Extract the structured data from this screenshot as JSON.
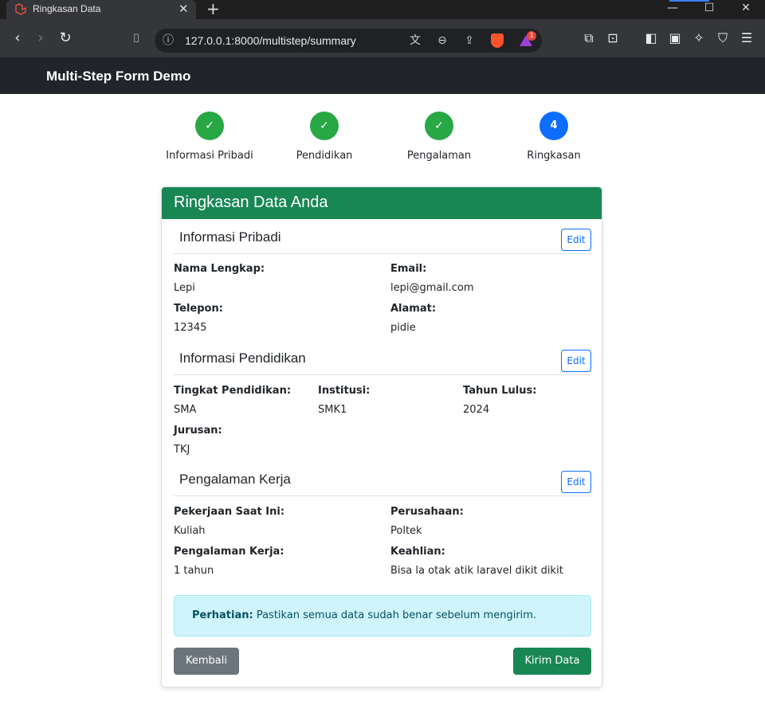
{
  "browser": {
    "tab_title": "Ringkasan Data",
    "url": "127.0.0.1:8000/multistep/summary",
    "rewards_badge": "1"
  },
  "app": {
    "brand": "Multi-Step Form Demo"
  },
  "steps": [
    {
      "label": "Informasi Pribadi",
      "marker": "✓",
      "status": "done"
    },
    {
      "label": "Pendidikan",
      "marker": "✓",
      "status": "done"
    },
    {
      "label": "Pengalaman",
      "marker": "✓",
      "status": "done"
    },
    {
      "label": "Ringkasan",
      "marker": "4",
      "status": "active"
    }
  ],
  "card": {
    "title": "Ringkasan Data Anda",
    "edit_label": "Edit",
    "personal": {
      "title": "Informasi Pribadi",
      "name_label": "Nama Lengkap:",
      "name": "Lepi",
      "email_label": "Email:",
      "email": "lepi@gmail.com",
      "phone_label": "Telepon:",
      "phone": "12345",
      "address_label": "Alamat:",
      "address": "pidie"
    },
    "education": {
      "title": "Informasi Pendidikan",
      "level_label": "Tingkat Pendidikan:",
      "level": "SMA",
      "institution_label": "Institusi:",
      "institution": "SMK1",
      "year_label": "Tahun Lulus:",
      "year": "2024",
      "major_label": "Jurusan:",
      "major": "TKJ"
    },
    "experience": {
      "title": "Pengalaman Kerja",
      "job_label": "Pekerjaan Saat Ini:",
      "job": "Kuliah",
      "company_label": "Perusahaan:",
      "company": "Poltek",
      "years_label": "Pengalaman Kerja:",
      "years": "1 tahun",
      "skills_label": "Keahlian:",
      "skills": "Bisa la otak atik laravel dikit dikit"
    },
    "alert": {
      "strong": "Perhatian:",
      "text": " Pastikan semua data sudah benar sebelum mengirim."
    },
    "back_label": "Kembali",
    "submit_label": "Kirim Data"
  },
  "colors": {
    "success": "#198754",
    "step_done": "#28a745",
    "step_active": "#0d6efd",
    "navbar": "#212529"
  }
}
